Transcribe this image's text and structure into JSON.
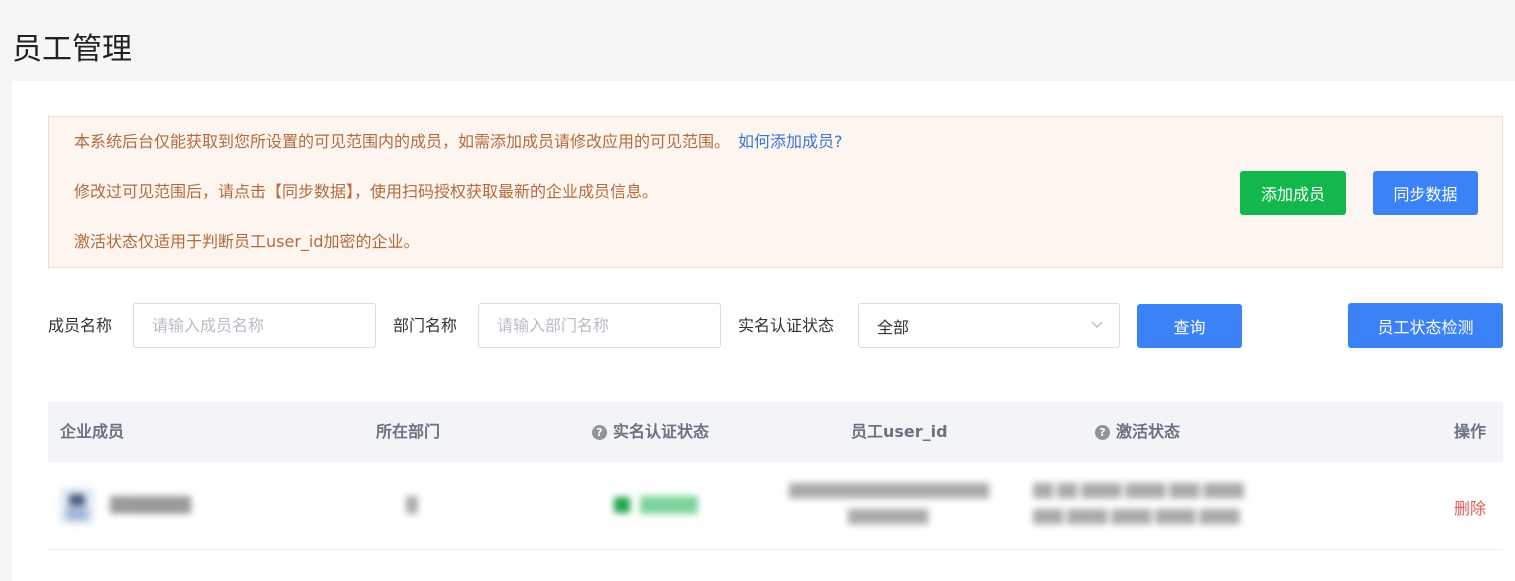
{
  "page": {
    "title": "员工管理"
  },
  "notice": {
    "line1": "本系统后台仅能获取到您所设置的可见范围内的成员，如需添加成员请修改应用的可见范围。",
    "help_link": "如何添加成员?",
    "line2": "修改过可见范围后，请点击【同步数据】，使用扫码授权获取最新的企业成员信息。",
    "line3": "激活状态仅适用于判断员工user_id加密的企业。",
    "add_member_label": "添加成员",
    "sync_data_label": "同步数据"
  },
  "filters": {
    "member_name_label": "成员名称",
    "member_name_placeholder": "请输入成员名称",
    "department_label": "部门名称",
    "department_placeholder": "请输入部门名称",
    "verify_status_label": "实名认证状态",
    "verify_status_value": "全部",
    "query_label": "查询",
    "status_check_label": "员工状态检测"
  },
  "table": {
    "columns": {
      "member": "企业成员",
      "department": "所在部门",
      "verify_status": "实名认证状态",
      "user_id": "员工user_id",
      "activation": "激活状态",
      "actions": "操作"
    },
    "rows": [
      {
        "name": "███████",
        "department": "█",
        "verify_status": "█████",
        "user_id_line1": "████████████████████",
        "user_id_line2": "████████",
        "activation_line1": "██ ██   ████ ████ ███ ████",
        "activation_line2": "███   ████ ████ ████ ████",
        "delete_label": "删除"
      }
    ]
  },
  "colors": {
    "primary": "#3b82f6",
    "success": "#12b84b",
    "notice_text": "#b56a3d",
    "danger": "#e05a5a"
  }
}
